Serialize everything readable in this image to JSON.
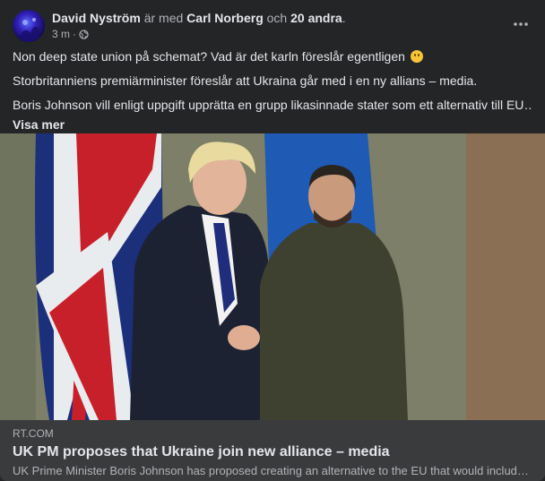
{
  "post": {
    "author": "David Nyström",
    "with_text": "är med",
    "tagged_person": "Carl Norberg",
    "and_text": "och",
    "others": "20 andra",
    "period": ".",
    "time": "3 m",
    "dot": "·",
    "privacy_icon": "globe-icon",
    "more_icon": "ellipsis-icon",
    "text_lines": [
      "Non deep state union på schemat? Vad är det karln föreslår egentligen",
      "Storbritanniens premiärminister föreslår att Ukraina går med i en ny allians – media.",
      "Boris Johnson vill enligt uppgift upprätta en grupp likasinnade stater som ett alternativ till EU…."
    ],
    "emoji": "slightly-smiling-face-icon",
    "see_more": "Visa mer"
  },
  "link": {
    "domain": "RT.COM",
    "title": "UK PM proposes that Ukraine join new alliance – media",
    "description": "UK Prime Minister Boris Johnson has proposed creating an alternative to the EU that would include…"
  },
  "colors": {
    "background": "#242526",
    "link_footer": "#3a3b3c",
    "primary_text": "#e4e6eb",
    "secondary_text": "#b0b3b8"
  }
}
